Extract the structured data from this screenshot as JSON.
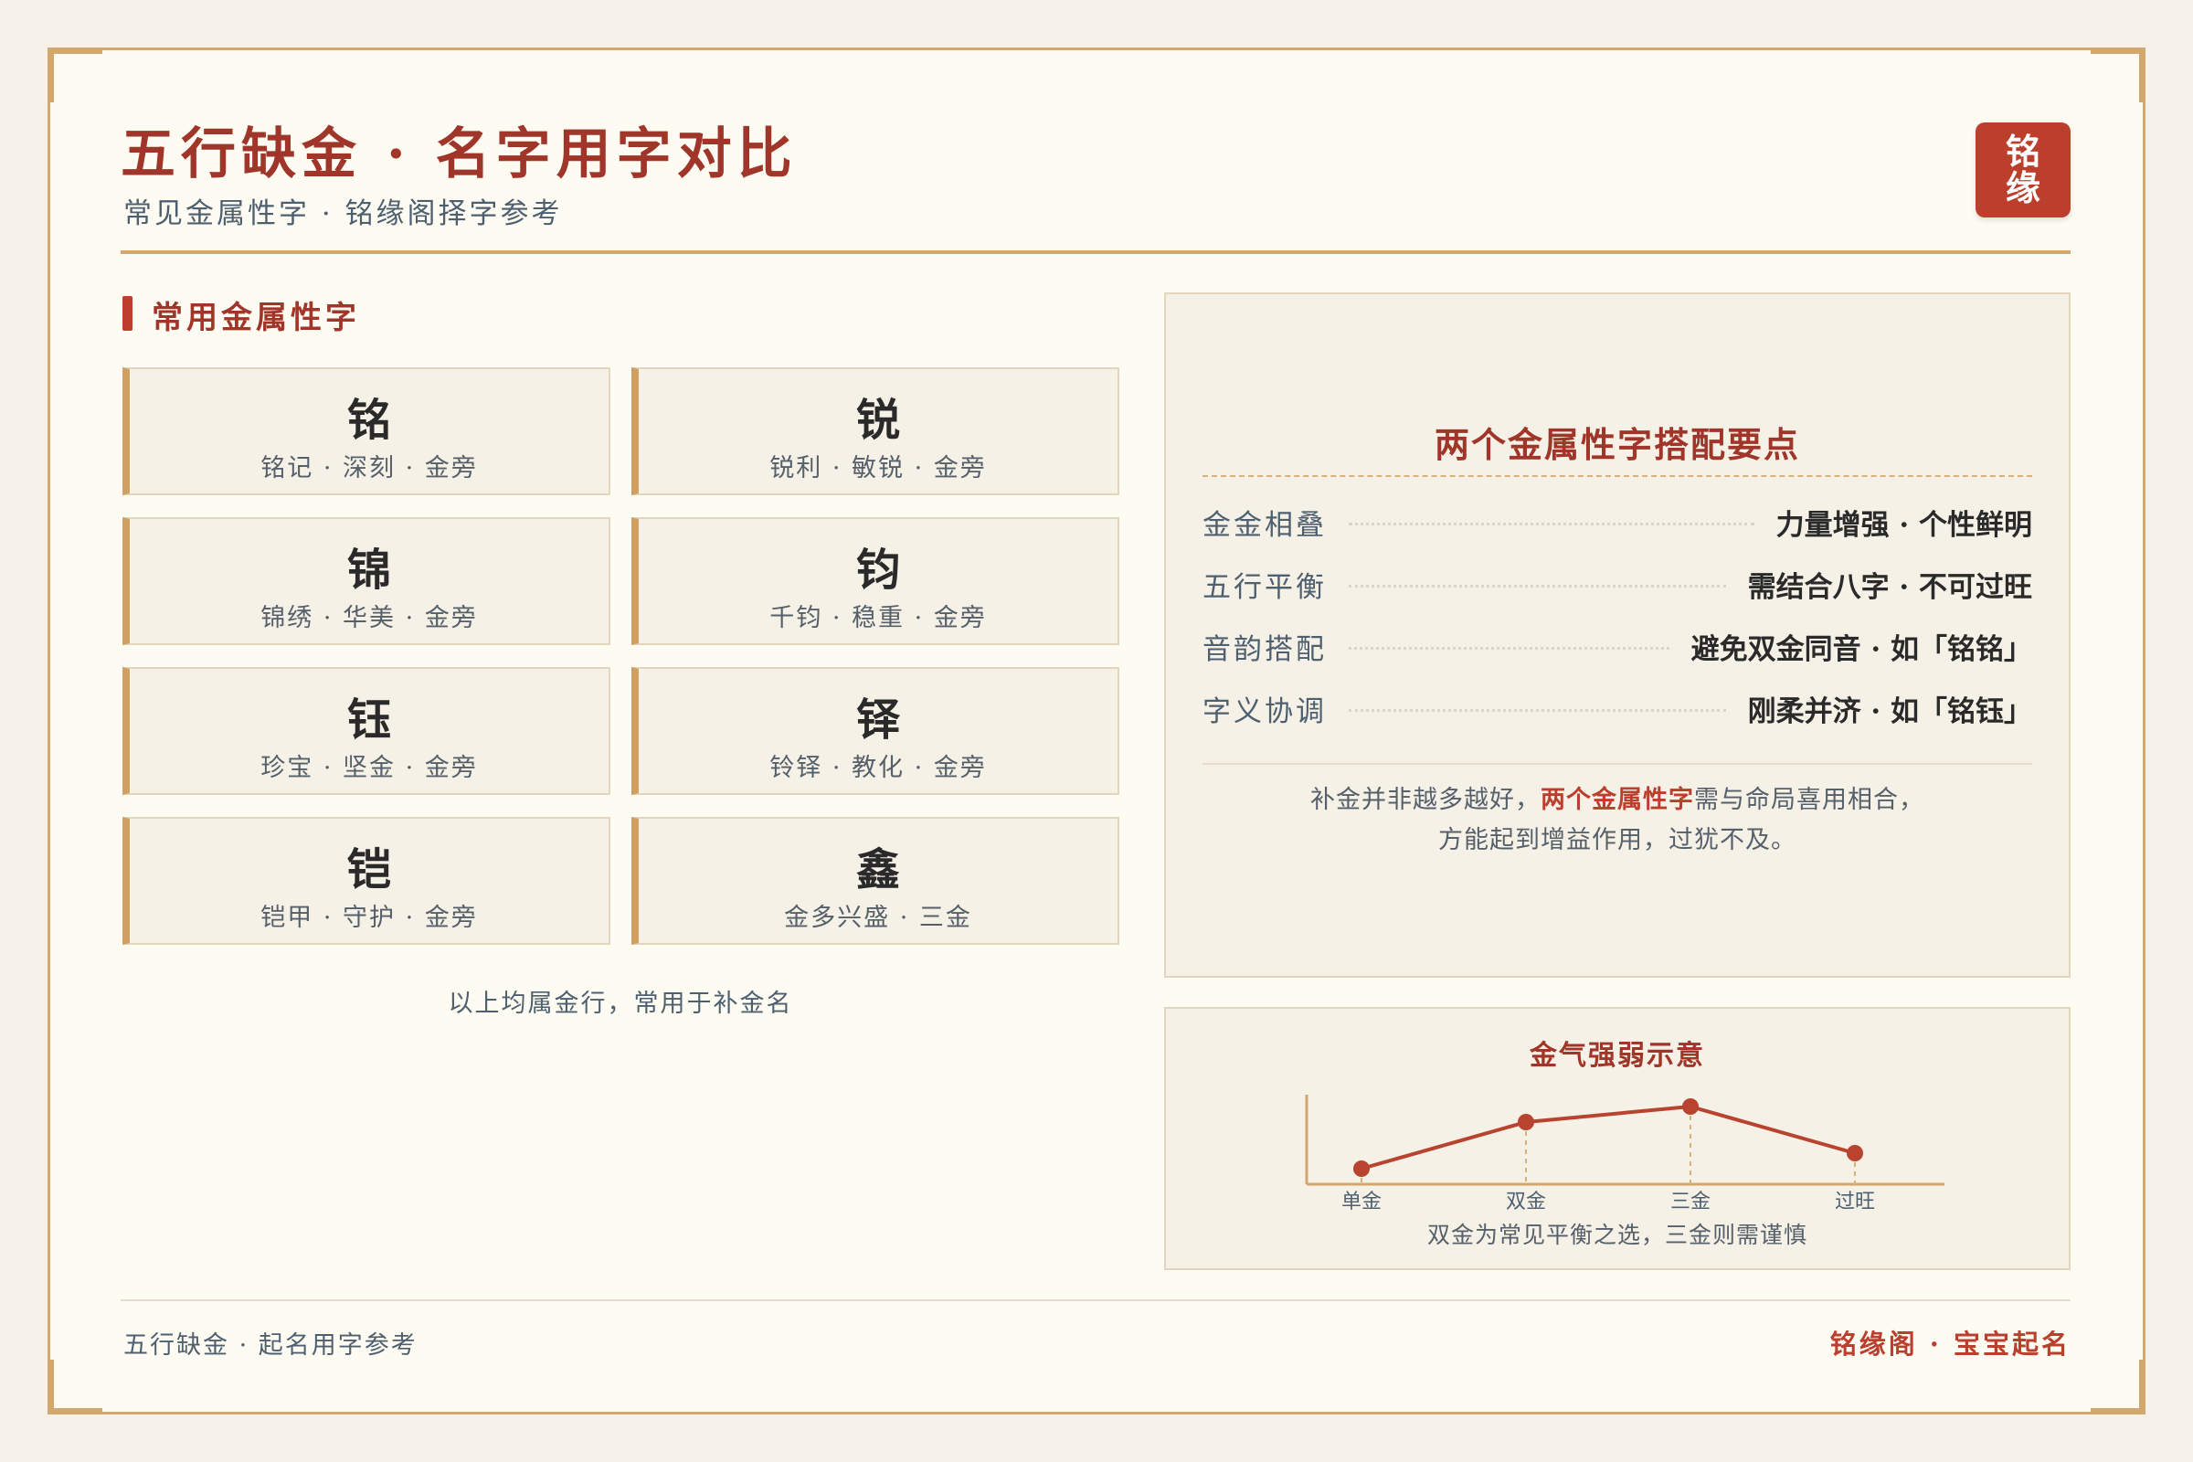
{
  "header": {
    "title": "五行缺金 · 名字用字对比",
    "subtitle": "常见金属性字 · 铭缘阁择字参考",
    "seal_line1": "铭",
    "seal_line2": "缘"
  },
  "characters_section": {
    "title": "常用金属性字",
    "cards": [
      {
        "char": "铭",
        "desc": "铭记 · 深刻 · 金旁"
      },
      {
        "char": "锐",
        "desc": "锐利 · 敏锐 · 金旁"
      },
      {
        "char": "锦",
        "desc": "锦绣 · 华美 · 金旁"
      },
      {
        "char": "钧",
        "desc": "千钧 · 稳重 · 金旁"
      },
      {
        "char": "钰",
        "desc": "珍宝 · 坚金 · 金旁"
      },
      {
        "char": "铎",
        "desc": "铃铎 · 教化 · 金旁"
      },
      {
        "char": "铠",
        "desc": "铠甲 · 守护 · 金旁"
      },
      {
        "char": "鑫",
        "desc": "金多兴盛 · 三金"
      }
    ],
    "note": "以上均属金行，常用于补金名"
  },
  "pairing": {
    "title": "两个金属性字搭配要点",
    "rows": [
      {
        "key": "金金相叠",
        "value": "力量增强 · 个性鲜明"
      },
      {
        "key": "五行平衡",
        "value": "需结合八字 · 不可过旺"
      },
      {
        "key": "音韵搭配",
        "value": "避免双金同音 · 如「铭铭」"
      },
      {
        "key": "字义协调",
        "value": "刚柔并济 · 如「铭钰」"
      }
    ],
    "note_pre": "补金并非越多越好，",
    "note_highlight": "两个金属性字",
    "note_post": "需与命局喜用相合，",
    "note_line2": "方能起到增益作用，过犹不及。"
  },
  "chart_data": {
    "type": "line",
    "title": "金气强弱示意",
    "categories": [
      "单金",
      "双金",
      "三金",
      "过旺"
    ],
    "series": [
      {
        "values": [
          1,
          4,
          5,
          2
        ]
      }
    ],
    "ylim": [
      0,
      6
    ],
    "note": "双金为常见平衡之选，三金则需谨慎",
    "color": "#b8432f",
    "grid": false
  },
  "footer": {
    "left": "五行缺金 · 起名用字参考",
    "right": "铭缘阁 · 宝宝起名"
  }
}
